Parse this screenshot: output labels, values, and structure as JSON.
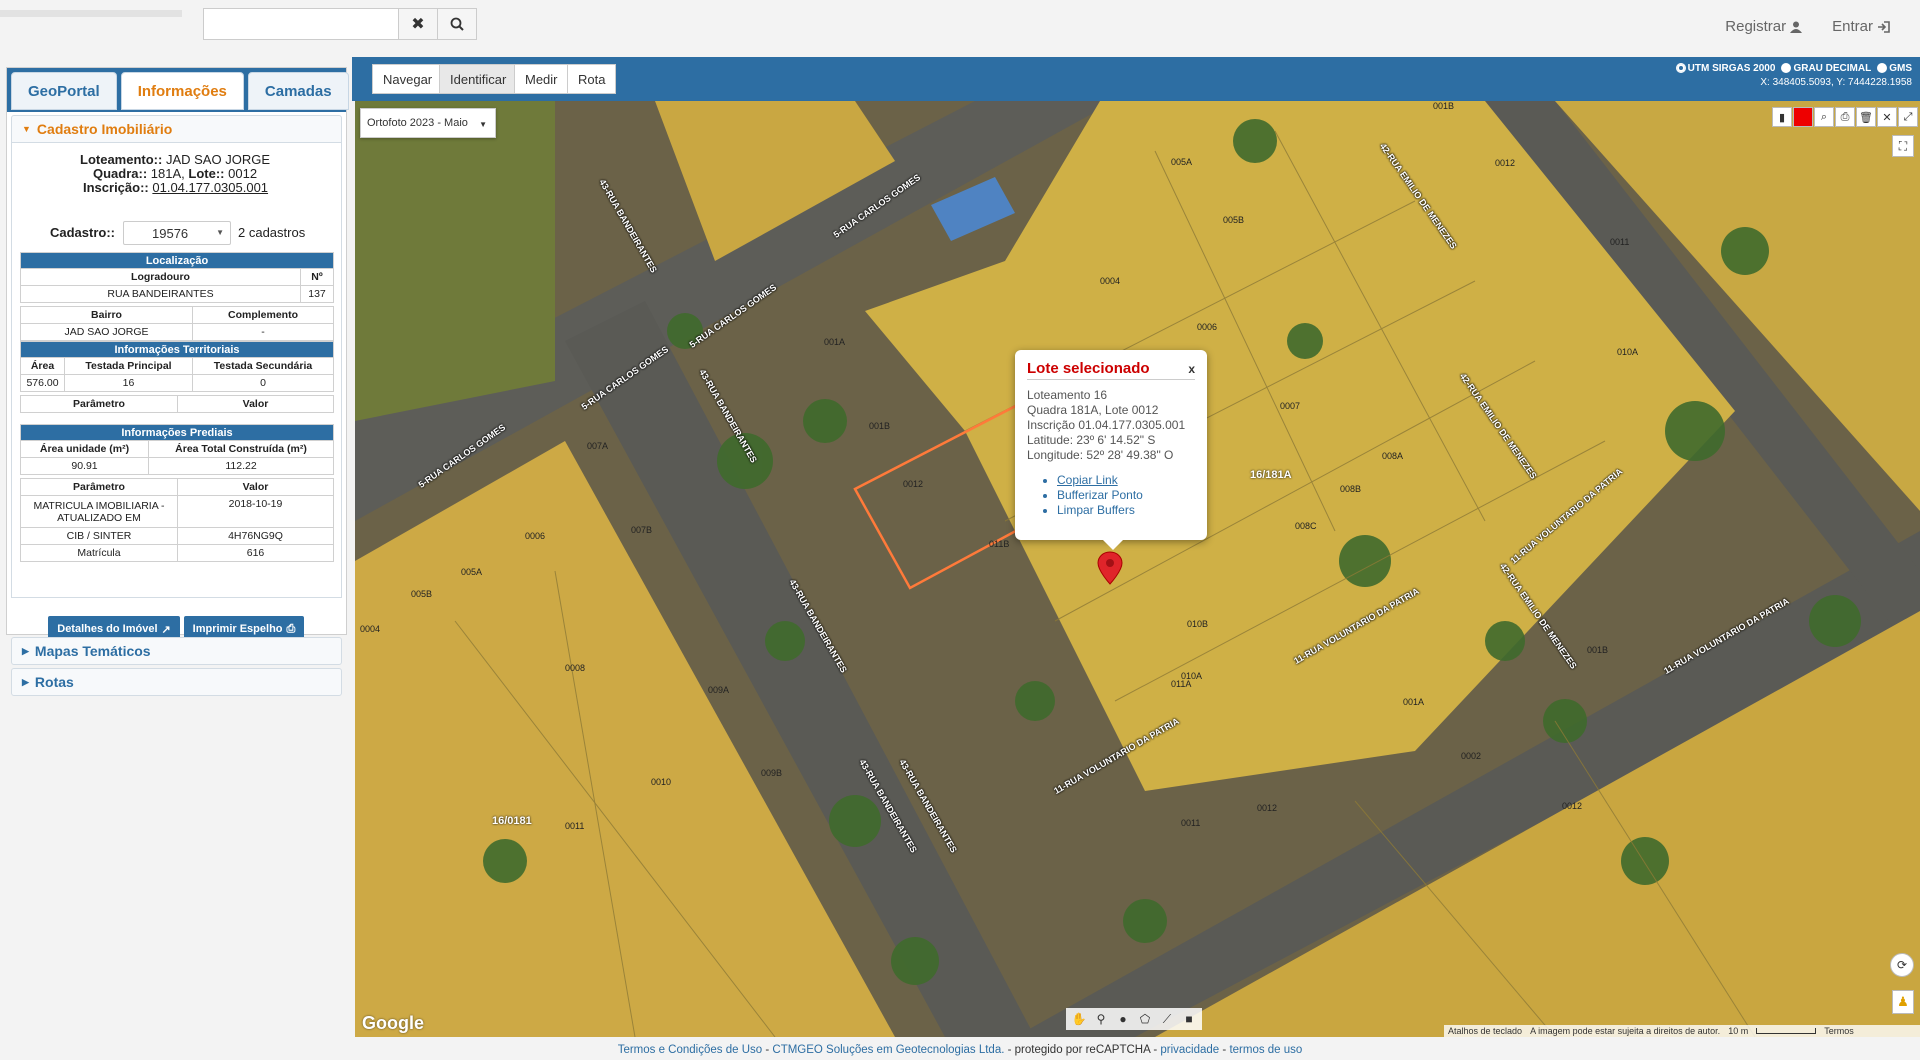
{
  "header": {
    "search_placeholder": "",
    "clear_icon": "times-icon",
    "search_icon": "search-icon",
    "register_label": "Registrar",
    "login_label": "Entrar"
  },
  "tabs": [
    {
      "label": "GeoPortal",
      "active": false
    },
    {
      "label": "Informações",
      "active": true
    },
    {
      "label": "Camadas",
      "active": false
    }
  ],
  "cadastro": {
    "section_title": "Cadastro Imobiliário",
    "loteamento_label": "Loteamento::",
    "loteamento_value": "JAD SAO JORGE",
    "quadra_label": "Quadra::",
    "quadra_value": "181A,",
    "lote_label": "Lote::",
    "lote_value": "0012",
    "inscricao_label": "Inscrição::",
    "inscricao_value": "01.04.177.0305.001",
    "cadastro_label": "Cadastro::",
    "cadastro_value": "19576",
    "cadastros_count": "2 cadastros",
    "localizacao": {
      "title": "Localização",
      "col_logradouro": "Logradouro",
      "col_numero": "Nº",
      "logradouro": "RUA BANDEIRANTES",
      "numero": "137",
      "col_bairro": "Bairro",
      "col_complemento": "Complemento",
      "bairro": "JAD SAO JORGE",
      "complemento": "-"
    },
    "territoriais": {
      "title": "Informações Territoriais",
      "col_area": "Área",
      "col_testada_principal": "Testada Principal",
      "col_testada_secundaria": "Testada Secundária",
      "area": "576.00",
      "testada_principal": "16",
      "testada_secundaria": "0",
      "col_parametro": "Parâmetro",
      "col_valor": "Valor"
    },
    "prediais": {
      "title": "Informações Prediais",
      "col_area_unidade": "Área unidade (m²)",
      "col_area_total": "Área Total Construída (m²)",
      "area_unidade": "90.91",
      "area_total": "112.22",
      "col_parametro": "Parâmetro",
      "col_valor": "Valor",
      "rows": [
        {
          "param": "MATRICULA IMOBILIARIA - ATUALIZADO EM",
          "value": "2018-10-19"
        },
        {
          "param": "CIB / SINTER",
          "value": "4H76NG9Q"
        },
        {
          "param": "Matrícula",
          "value": "616"
        }
      ]
    },
    "detalhes_button": "Detalhes do Imóvel",
    "imprimir_button": "Imprimir Espelho"
  },
  "accordions": {
    "mapas": "Mapas Temáticos",
    "rotas": "Rotas"
  },
  "map_toolbar": {
    "modes": [
      {
        "label": "Navegar",
        "active": false
      },
      {
        "label": "Identificar",
        "active": true
      },
      {
        "label": "Medir",
        "active": false
      },
      {
        "label": "Rota",
        "active": false
      }
    ],
    "coord_options": [
      {
        "label": "UTM SIRGAS 2000",
        "selected": true
      },
      {
        "label": "GRAU DECIMAL",
        "selected": false
      },
      {
        "label": "GMS",
        "selected": false
      }
    ],
    "coord_readout": "X: 348405.5093, Y: 7444228.1958"
  },
  "map": {
    "layer_select": "Ortofoto 2023 - Maio",
    "google_logo": "Google",
    "attribution": {
      "shortcuts": "Atalhos de teclado",
      "copyright": "A imagem pode estar sujeita a direitos de autor.",
      "scale": "10 m",
      "terms": "Termos"
    },
    "lot_labels": [
      "0012",
      "001A",
      "001B",
      "011B",
      "011A",
      "010B",
      "010A",
      "0009",
      "008B",
      "008C",
      "008A",
      "0007",
      "0006",
      "0004",
      "005A",
      "005B",
      "0012",
      "0011",
      "010A",
      "001B",
      "001A",
      "0002",
      "0012",
      "0011",
      "007A",
      "007B",
      "0006",
      "005A",
      "005B",
      "0004",
      "0008",
      "009A",
      "009B",
      "0010",
      "0011",
      "0012",
      "001B"
    ],
    "block_labels": [
      "16/181A",
      "16/0181"
    ],
    "street_labels": [
      "5-RUA CARLOS GOMES",
      "5-RUA CARLOS GOMES",
      "5-RUA CARLOS GOMES",
      "5-RUA CARLOS GOMES",
      "43-RUA BANDEIRANTES",
      "43-RUA BANDEIRANTES",
      "43-RUA BANDEIRANTES",
      "43-RUA BANDEIRANTES",
      "43-RUA BANDEIRANTES",
      "42-RUA EMILIO DE MENEZES",
      "42-RUA EMILIO DE MENEZES",
      "42-RUA EMILIO DE MENEZES",
      "11-RUA VOLUNTARIO DA PATRIA",
      "11-RUA VOLUNTARIO DA PATRIA",
      "11-RUA VOLUNTARIO DA PATRIA",
      "11-RUA VOLUNTARIO DA PATRIA"
    ]
  },
  "popup": {
    "title": "Lote selecionado",
    "close": "x",
    "lines": [
      "Loteamento 16",
      "Quadra 181A, Lote 0012",
      "Inscrição 01.04.177.0305.001",
      "Latitude: 23º 6' 14.52\" S",
      "Longitude: 52º 28' 49.38\" O"
    ],
    "links": [
      "Copiar Link",
      "Bufferizar Ponto",
      "Limpar Buffers"
    ]
  },
  "footer": {
    "terms": "Termos e Condições de Uso",
    "sep1": " - ",
    "company": "CTMGEO Soluções em Geotecnologias Ltda.",
    "protected": " - protegido por reCAPTCHA - ",
    "privacy": "privacidade",
    "sep2": " - ",
    "tos": "termos de uso"
  },
  "colors": {
    "primary": "#2d6ea3",
    "active_tab": "#e07d10",
    "popup_title": "#cc0000",
    "lot_fill": "#d4b43c",
    "selected_lot": "#ff7a3a"
  }
}
